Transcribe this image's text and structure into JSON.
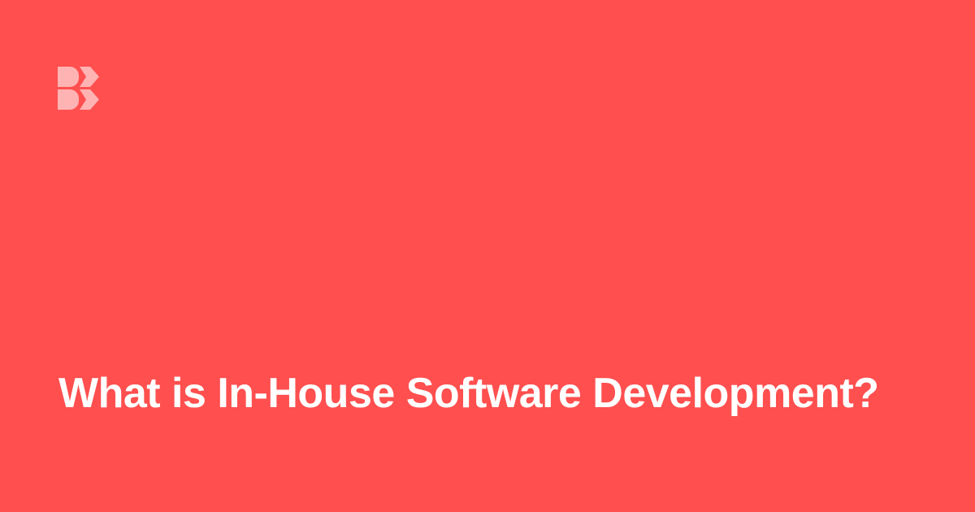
{
  "brand": {
    "logo_icon": "brand-logo-icon",
    "background_color": "#FF4F4F",
    "logo_color": "#FFB3B3"
  },
  "article": {
    "title": "What is In-House Software Development?",
    "title_color": "#FFFFFF"
  }
}
